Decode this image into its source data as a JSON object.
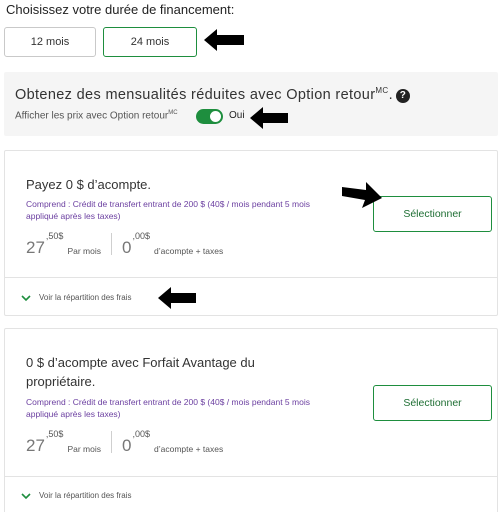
{
  "financing": {
    "title": "Choisissez votre durée de financement:",
    "options": [
      {
        "label": "12 mois",
        "selected": false
      },
      {
        "label": "24 mois",
        "selected": true
      }
    ]
  },
  "option_retour": {
    "title": "Obtenez des mensualités réduites avec Option retour",
    "title_sup": "MC",
    "title_punct": ".",
    "help_icon": "question-circle-icon",
    "toggle_label": "Afficher les prix avec Option retour",
    "toggle_label_sup": "MC",
    "toggle_state": "Oui",
    "toggle_on": true
  },
  "plans": [
    {
      "heading": "Payez 0 $ d’acompte.",
      "includes": "Comprend : Crédit de transfert entrant de 200 $ (40$ / mois pendant 5 mois appliqué après les taxes)",
      "monthly": {
        "whole": "27",
        "sup": ",50$",
        "label": "Par mois"
      },
      "down": {
        "whole": "0",
        "sup": ",00$",
        "label": "d’acompte + taxes"
      },
      "select_label": "Sélectionner",
      "breakdown_label": "Voir la répartition des frais"
    },
    {
      "heading": "0 $ d’acompte avec Forfait Avantage du propriétaire.",
      "includes": "Comprend : Crédit de transfert entrant de 200 $ (40$ / mois pendant 5 mois appliqué après les taxes)",
      "monthly": {
        "whole": "27",
        "sup": ",50$",
        "label": "Par mois"
      },
      "down": {
        "whole": "0",
        "sup": ",00$",
        "label": "d’acompte + taxes"
      },
      "select_label": "Sélectionner",
      "breakdown_label": "Voir la répartition des frais"
    }
  ],
  "colors": {
    "accent_green": "#1e8e3e",
    "includes_purple": "#6b3fa0",
    "panel_bg": "#f5f5f5"
  },
  "annotations": [
    "arrow-icon",
    "arrow-icon",
    "arrow-icon",
    "arrow-icon"
  ]
}
